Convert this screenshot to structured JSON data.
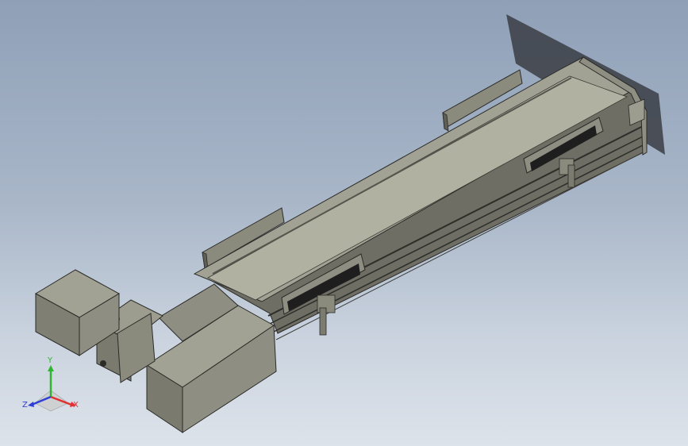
{
  "view": {
    "background_top": "#8fa0b7",
    "background_bottom": "#dde3ea"
  },
  "model": {
    "body_color": "#8e8e82",
    "top_color": "#a2a294",
    "dark_color": "#5f5f56",
    "edge_color": "#2b2b28",
    "cable_color": "#1e1e1e"
  },
  "triad": {
    "x_label": "X",
    "y_label": "Y",
    "z_label": "Z",
    "x_color": "#e23030",
    "y_color": "#2fb52f",
    "z_color": "#2d3fd6"
  }
}
